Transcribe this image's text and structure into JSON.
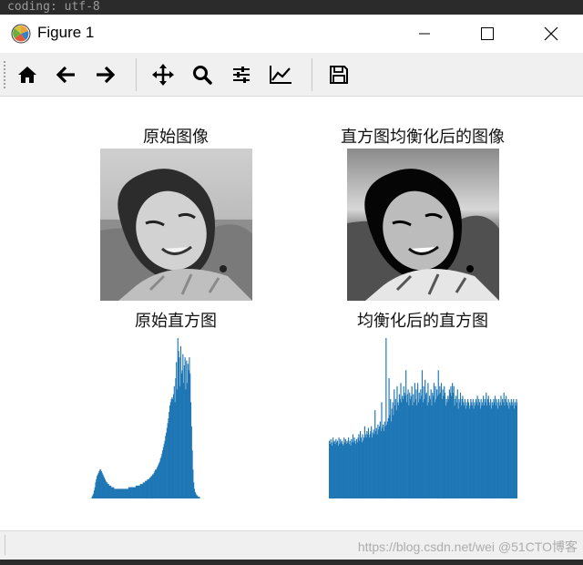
{
  "editor": {
    "background_text": "coding: utf-8"
  },
  "window": {
    "title": "Figure 1"
  },
  "window_controls": {
    "minimize_icon": "minimize-icon",
    "maximize_icon": "maximize-icon",
    "close_icon": "close-icon"
  },
  "toolbar": {
    "buttons": [
      {
        "icon": "home-icon"
      },
      {
        "icon": "back-arrow-icon"
      },
      {
        "icon": "forward-arrow-icon"
      },
      {
        "icon": "pan-move-icon"
      },
      {
        "icon": "zoom-magnifier-icon"
      },
      {
        "icon": "configure-subplots-icon"
      },
      {
        "icon": "edit-axis-icon"
      },
      {
        "icon": "save-floppy-icon"
      }
    ]
  },
  "plots": {
    "original_image_title": "原始图像",
    "equalized_image_title": "直方图均衡化后的图像",
    "original_hist_title": "原始直方图",
    "equalized_hist_title": "均衡化后的直方图"
  },
  "status": {
    "watermark": "https://blog.csdn.net/wei @51CTO博客"
  },
  "colors": {
    "bar": "#1f77b4",
    "toolbar_bg": "#f0f0f0"
  },
  "chart_data": [
    {
      "type": "bar",
      "name": "original_histogram",
      "title": "原始直方图",
      "xlim": [
        0,
        255
      ],
      "ylim": [
        0,
        100
      ],
      "values": [
        0,
        0,
        0,
        0,
        0,
        0,
        0,
        0,
        0,
        0,
        0,
        0,
        1,
        2,
        3,
        5,
        7,
        10,
        12,
        14,
        15,
        16,
        17,
        18,
        18,
        17,
        16,
        15,
        14,
        13,
        12,
        11,
        10,
        10,
        9,
        9,
        8,
        8,
        8,
        7,
        7,
        7,
        7,
        6,
        6,
        6,
        6,
        6,
        6,
        6,
        6,
        6,
        6,
        6,
        6,
        6,
        6,
        6,
        6,
        6,
        6,
        6,
        6,
        7,
        7,
        7,
        7,
        7,
        7,
        7,
        7,
        7,
        7,
        8,
        8,
        8,
        8,
        8,
        8,
        9,
        9,
        9,
        9,
        10,
        10,
        10,
        11,
        11,
        11,
        12,
        12,
        12,
        13,
        13,
        14,
        14,
        15,
        15,
        16,
        17,
        18,
        18,
        19,
        20,
        21,
        22,
        23,
        25,
        26,
        28,
        30,
        32,
        34,
        36,
        39,
        41,
        44,
        47,
        50,
        54,
        58,
        60,
        62,
        63,
        62,
        65,
        70,
        60,
        75,
        85,
        68,
        100,
        92,
        88,
        70,
        95,
        78,
        80,
        90,
        72,
        83,
        88,
        68,
        86,
        72,
        84,
        80,
        88,
        78,
        60,
        45,
        30,
        18,
        10,
        6,
        4,
        3,
        2,
        2,
        1,
        1,
        1,
        0,
        0,
        0,
        0,
        0,
        0,
        0,
        0,
        0,
        0,
        0,
        0,
        0,
        0,
        0,
        0,
        0,
        0,
        0,
        0,
        0,
        0,
        0,
        0,
        0,
        0,
        0,
        0,
        0,
        0,
        0,
        0,
        0,
        0,
        0,
        0,
        0,
        0,
        0,
        0,
        0,
        0,
        0,
        0,
        0,
        0,
        0,
        0,
        0,
        0,
        0,
        0,
        0,
        0,
        0,
        0,
        0,
        0,
        0,
        0,
        0,
        0,
        0,
        0,
        0,
        0,
        0,
        0,
        0,
        0,
        0,
        0,
        0,
        0,
        0,
        0,
        0,
        0,
        0,
        0,
        0,
        0,
        0,
        0,
        0,
        0,
        0,
        0,
        0,
        0,
        0,
        0,
        0,
        0,
        0,
        0,
        0
      ]
    },
    {
      "type": "bar",
      "name": "equalized_histogram",
      "title": "均衡化后的直方图",
      "xlim": [
        0,
        255
      ],
      "ylim": [
        0,
        100
      ],
      "values": [
        36,
        34,
        37,
        35,
        33,
        38,
        35,
        36,
        34,
        37,
        35,
        36,
        33,
        38,
        34,
        37,
        35,
        36,
        34,
        33,
        38,
        35,
        37,
        34,
        36,
        35,
        38,
        34,
        36,
        33,
        37,
        35,
        40,
        35,
        38,
        36,
        34,
        37,
        35,
        38,
        40,
        36,
        42,
        38,
        35,
        40,
        36,
        38,
        45,
        40,
        38,
        42,
        40,
        44,
        38,
        40,
        42,
        45,
        38,
        41,
        43,
        40,
        55,
        42,
        44,
        40,
        46,
        43,
        45,
        48,
        42,
        60,
        44,
        46,
        42,
        48,
        45,
        100,
        46,
        48,
        50,
        75,
        52,
        62,
        48,
        56,
        60,
        52,
        68,
        58,
        62,
        55,
        70,
        60,
        58,
        65,
        62,
        72,
        60,
        64,
        62,
        70,
        66,
        64,
        80,
        60,
        65,
        68,
        58,
        66,
        62,
        64,
        70,
        58,
        65,
        60,
        72,
        62,
        68,
        58,
        72,
        60,
        66,
        62,
        68,
        64,
        80,
        60,
        70,
        62,
        74,
        65,
        66,
        58,
        72,
        60,
        64,
        62,
        68,
        58,
        66,
        64,
        72,
        60,
        70,
        62,
        68,
        64,
        80,
        65,
        70,
        66,
        72,
        62,
        68,
        64,
        70,
        66,
        58,
        62,
        60,
        64,
        62,
        68,
        66,
        70,
        64,
        72,
        66,
        70,
        58,
        62,
        64,
        60,
        68,
        56,
        62,
        60,
        66,
        58,
        62,
        64,
        60,
        58,
        62,
        56,
        60,
        58,
        62,
        60,
        56,
        58,
        62,
        60,
        58,
        62,
        56,
        60,
        58,
        62,
        60,
        64,
        58,
        62,
        60,
        56,
        62,
        58,
        60,
        64,
        58,
        62,
        60,
        66,
        58,
        62,
        64,
        60,
        58,
        62,
        56,
        60,
        58,
        62,
        60,
        64,
        58,
        62,
        60,
        56,
        62,
        58,
        60,
        64,
        58,
        62,
        60,
        66,
        58,
        62,
        64,
        60,
        58,
        62,
        56,
        60,
        58,
        62,
        60,
        58,
        62,
        56,
        60,
        58,
        62,
        60
      ]
    }
  ]
}
